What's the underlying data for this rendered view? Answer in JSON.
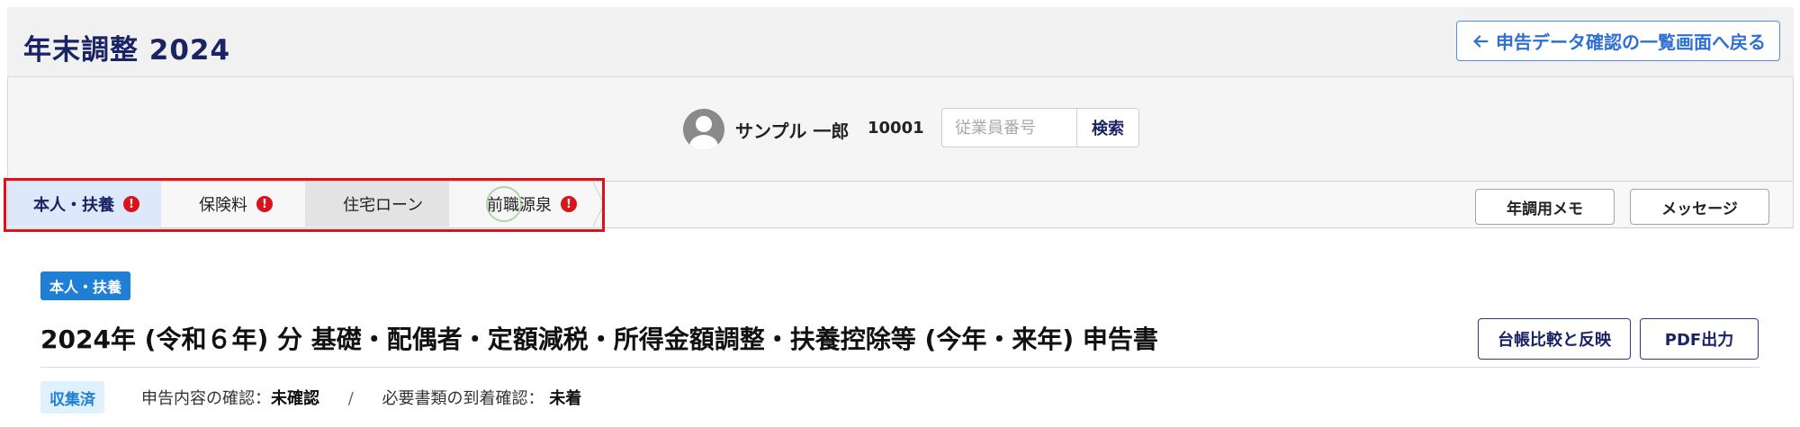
{
  "header": {
    "title": "年末調整 2024",
    "back_label": "申告データ確認の一覧画面へ戻る"
  },
  "employee": {
    "name": "サンプル 一郎",
    "number": "10001",
    "search_placeholder": "従業員番号",
    "search_button": "検索"
  },
  "steps": [
    {
      "label": "本人・扶養",
      "alert": true,
      "active": true
    },
    {
      "label": "保険料",
      "alert": true
    },
    {
      "label": "住宅ローン",
      "alert": false
    },
    {
      "label": "前職源泉",
      "alert": true
    }
  ],
  "toolbar": {
    "memo_label": "年調用メモ",
    "message_label": "メッセージ"
  },
  "content": {
    "section_tag": "本人・扶養",
    "doc_title": "2024年 (令和６年) 分 基礎・配偶者・定額減税・所得金額調整・扶養控除等 (今年・来年) 申告書",
    "compare_button": "台帳比較と反映",
    "pdf_button": "PDF出力",
    "status_badge": "収集済",
    "confirm_label": "申告内容の確認：",
    "confirm_value": "未確認",
    "separator": "/",
    "arrival_label": "必要書類の到着確認：",
    "arrival_value": "未着"
  },
  "colors": {
    "brand_navy": "#1a2366",
    "accent_blue": "#1f7fd4",
    "alert_red": "#d9141a",
    "highlight_red": "#e0101a"
  },
  "icons": {
    "back": "arrow-left-icon",
    "alert": "exclamation-icon",
    "avatar": "user-avatar-icon"
  }
}
